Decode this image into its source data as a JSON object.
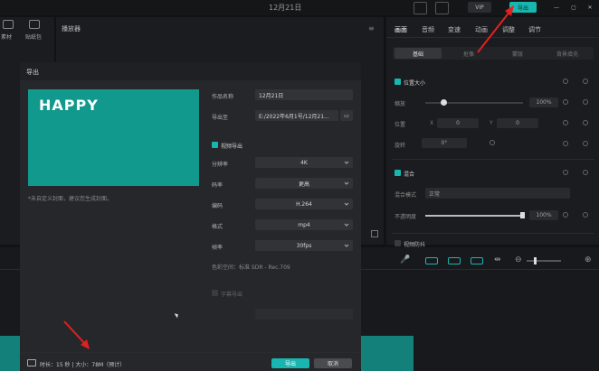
{
  "titlebar": {
    "title": "12月21日",
    "vip_label": "VIP",
    "export_label": "导出"
  },
  "left_toolbar": {
    "item1": "素材",
    "item2": "贴纸包"
  },
  "player": {
    "title": "播放器"
  },
  "right_panel": {
    "tabs": [
      "画面",
      "音频",
      "变速",
      "动画",
      "调整",
      "调节"
    ],
    "subtabs": [
      "基础",
      "抠像",
      "蒙版",
      "背景填充"
    ],
    "section_position": "位置大小",
    "scale_label": "缩放",
    "scale_value": "100%",
    "pos_label": "位置",
    "x_value": "0",
    "y_value": "0",
    "rotate_label": "旋转",
    "rotate_value": "0°",
    "section_mix": "混合",
    "mix_mode_label": "混合模式",
    "mix_mode_value": "正常",
    "opacity_label": "不透明度",
    "opacity_value": "100%",
    "image_anti": "视频防抖"
  },
  "dialog": {
    "title": "导出",
    "preview_text": "HAPPY",
    "preview_note": "*未自定义封面，建议您生成封面。",
    "name_label": "作品名称",
    "name_value": "12月21日",
    "path_label": "导出至",
    "path_value": "E:/2022年6月1号/12月21...",
    "video_export_label": "视频导出",
    "resolution_label": "分辨率",
    "resolution_value": "4K",
    "bitrate_label": "码率",
    "bitrate_value": "更高",
    "codec_label": "编码",
    "codec_value": "H.264",
    "format_label": "格式",
    "format_value": "mp4",
    "fps_label": "帧率",
    "fps_value": "30fps",
    "color_label": "色彩空间：标准 SDR - Rec.709",
    "subtitle_label": "字幕导出",
    "footer_info": "时长：15 秒 | 大小：78M（预计）",
    "export_btn": "导出",
    "cancel_btn": "取消"
  },
  "colors": {
    "accent": "#19b6b1",
    "preview_bg": "#11998e",
    "arrow": "#e32020"
  }
}
